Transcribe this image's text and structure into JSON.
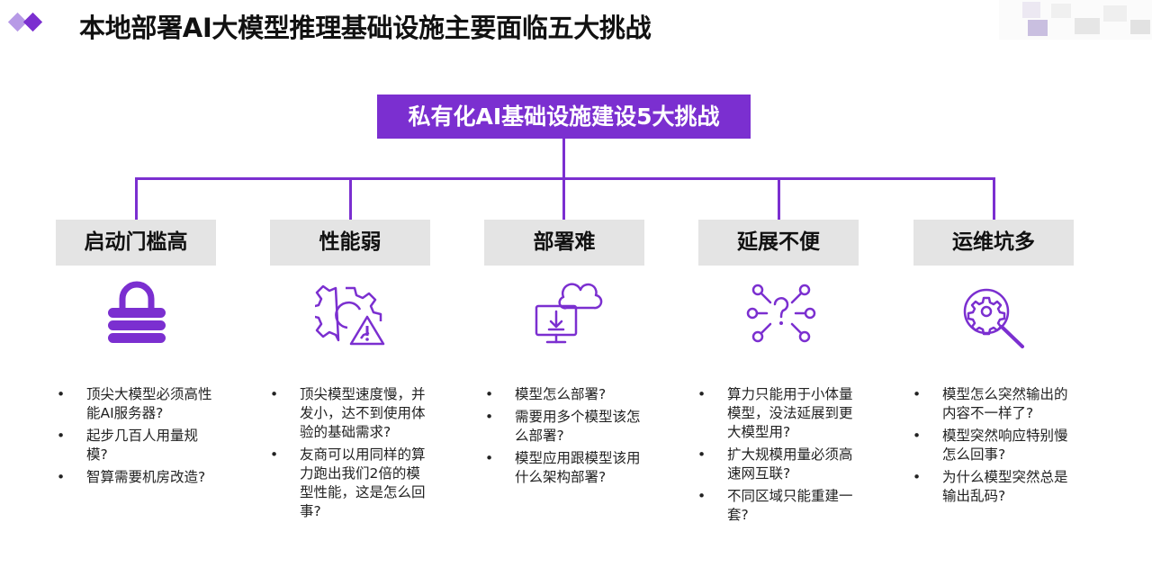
{
  "header": {
    "title": "本地部署AI大模型推理基础设施主要面临五大挑战"
  },
  "colors": {
    "accent": "#7b2fd0",
    "category_bg": "#e4e4e4"
  },
  "diagram": {
    "root": "私有化AI基础设施建设5大挑战",
    "categories": [
      {
        "title": "启动门槛高",
        "icon": "lock-icon",
        "bullets": [
          "顶尖大模型必须高性能AI服务器?",
          "起步几百人用量规模?",
          "智算需要机房改造?"
        ]
      },
      {
        "title": "性能弱",
        "icon": "gear-warning-icon",
        "bullets": [
          "顶尖模型速度慢，并发小，达不到使用体验的基础需求?",
          "友商可以用同样的算力跑出我们2倍的模型性能，这是怎么回事?"
        ]
      },
      {
        "title": "部署难",
        "icon": "cloud-download-monitor-icon",
        "bullets": [
          "模型怎么部署?",
          "需要用多个模型该怎么部署?",
          "模型应用跟模型该用什么架构部署?"
        ]
      },
      {
        "title": "延展不便",
        "icon": "network-question-icon",
        "bullets": [
          "算力只能用于小体量模型，没法延展到更大模型用?",
          "扩大规模用量必须高速网互联?",
          "不同区域只能重建一套?"
        ]
      },
      {
        "title": "运维坑多",
        "icon": "gear-magnifier-icon",
        "bullets": [
          "模型怎么突然输出的内容不一样了?",
          "模型突然响应特别慢怎么回事?",
          "为什么模型突然总是输出乱码?"
        ]
      }
    ]
  }
}
